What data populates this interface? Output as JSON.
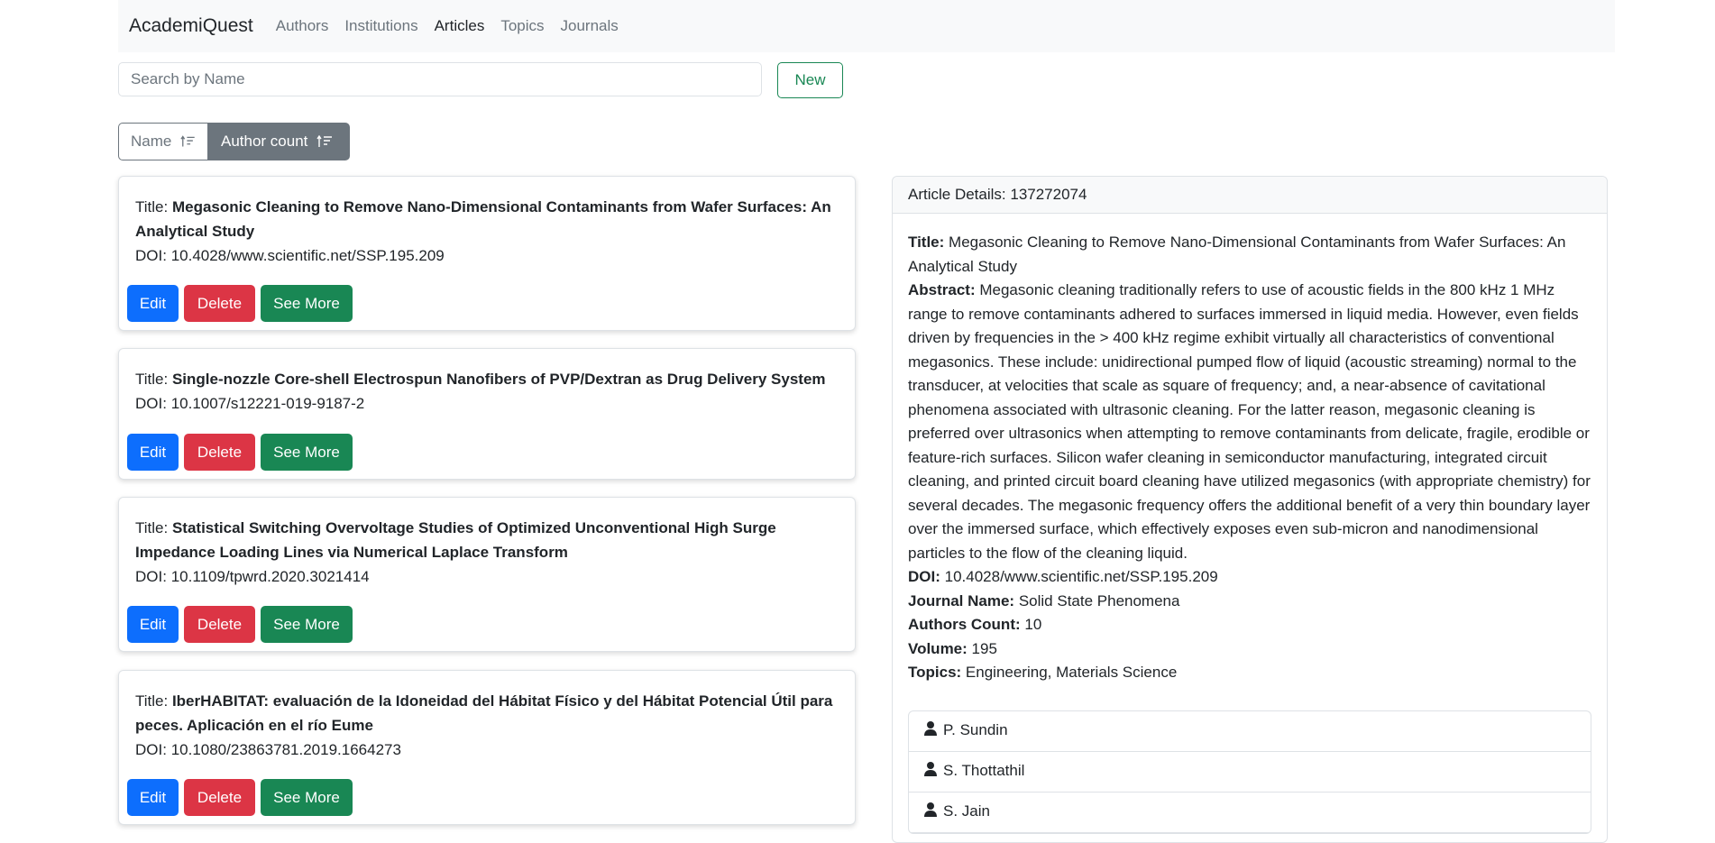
{
  "navbar": {
    "brand": "AcademiQuest",
    "links": [
      "Authors",
      "Institutions",
      "Articles",
      "Topics",
      "Journals"
    ],
    "active": "Articles"
  },
  "search": {
    "placeholder": "Search by Name",
    "value": ""
  },
  "new_button": "New",
  "sort": {
    "name_label": "Name",
    "count_label": "Author count",
    "active": "Author count"
  },
  "articles": [
    {
      "title_label": "Title:",
      "title": "Megasonic Cleaning to Remove Nano-Dimensional Contaminants from Wafer Surfaces: An Analytical Study",
      "doi_label": "DOI:",
      "doi": "10.4028/www.scientific.net/SSP.195.209"
    },
    {
      "title_label": "Title:",
      "title": "Single-nozzle Core-shell Electrospun Nanofibers of PVP/Dextran as Drug Delivery System",
      "doi_label": "DOI:",
      "doi": "10.1007/s12221-019-9187-2"
    },
    {
      "title_label": "Title:",
      "title": "Statistical Switching Overvoltage Studies of Optimized Unconventional High Surge Impedance Loading Lines via Numerical Laplace Transform",
      "doi_label": "DOI:",
      "doi": "10.1109/tpwrd.2020.3021414"
    },
    {
      "title_label": "Title:",
      "title": "IberHABITAT: evaluación de la Idoneidad del Hábitat Físico y del Hábitat Potencial Útil para peces. Aplicación en el río Eume",
      "doi_label": "DOI:",
      "doi": "10.1080/23863781.2019.1664273"
    }
  ],
  "card_buttons": {
    "edit": "Edit",
    "delete": "Delete",
    "more": "See More"
  },
  "detail": {
    "header": "Article Details: 137272074",
    "title_label": "Title:",
    "title": "Megasonic Cleaning to Remove Nano-Dimensional Contaminants from Wafer Surfaces: An Analytical Study",
    "abstract_label": "Abstract:",
    "abstract": "Megasonic cleaning traditionally refers to use of acoustic fields in the 800 kHz 1 MHz range to remove contaminants adhered to surfaces immersed in liquid media. However, even fields driven by frequencies in the > 400 kHz regime exhibit virtually all characteristics of conventional megasonics. These include: unidirectional pumped flow of liquid (acoustic streaming) normal to the transducer, at velocities that scale as square of frequency; and, a near-absence of cavitational phenomena associated with ultrasonic cleaning. For the latter reason, megasonic cleaning is preferred over ultrasonics when attempting to remove contaminants from delicate, fragile, erodible or feature-rich surfaces. Silicon wafer cleaning in semiconductor manufacturing, integrated circuit cleaning, and printed circuit board cleaning have utilized megasonics (with appropriate chemistry) for several decades. The megasonic frequency offers the additional benefit of a very thin boundary layer over the immersed surface, which effectively exposes even sub-micron and nanodimensional particles to the flow of the cleaning liquid.",
    "doi_label": "DOI:",
    "doi": "10.4028/www.scientific.net/SSP.195.209",
    "journal_label": "Journal Name:",
    "journal": "Solid State Phenomena",
    "authors_count_label": "Authors Count:",
    "authors_count": "10",
    "volume_label": "Volume:",
    "volume": "195",
    "topics_label": "Topics:",
    "topics": "Engineering, Materials Science",
    "authors": [
      "P. Sundin",
      "S. Thottathil",
      "S. Jain"
    ]
  },
  "colors": {
    "primary": "#0d6efd",
    "danger": "#dc3545",
    "success": "#198754",
    "secondary": "#6c757d",
    "navbar_bg": "#f8f9fa"
  },
  "icons": {
    "sort": "sort-ascending-icon",
    "author": "person-icon"
  }
}
